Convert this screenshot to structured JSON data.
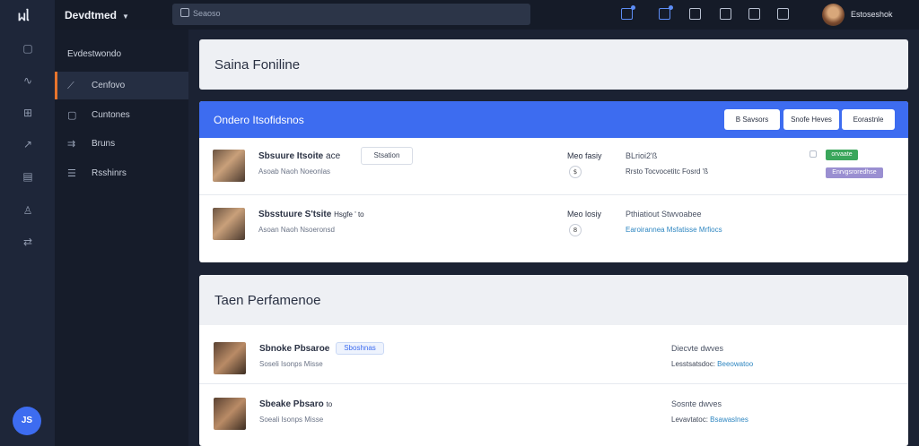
{
  "app": {
    "logo": "ᥕᥣ",
    "brand": "Devdtmed",
    "search_placeholder": "Seaoso",
    "user_name": "Estoseshok",
    "fab_label": "JS"
  },
  "rail_icons": [
    "square-icon",
    "chart-icon",
    "grid-icon",
    "trend-icon",
    "calendar-icon",
    "user-icon",
    "share-icon"
  ],
  "nav": {
    "heading": "Evdestwondo",
    "items": [
      {
        "label": "Cenfovo",
        "icon": "chart-line-icon",
        "active": true
      },
      {
        "label": "Cuntones",
        "icon": "card-icon",
        "active": false
      },
      {
        "label": "Bruns",
        "icon": "shuffle-icon",
        "active": false
      },
      {
        "label": "Rsshinrs",
        "icon": "list-icon",
        "active": false
      }
    ]
  },
  "main": {
    "page_title": "Saina Foniline",
    "list": {
      "title": "Ondero Itsofidsnos",
      "buttons": [
        "B Savsors",
        "Snofe Heves",
        "Eorastnle"
      ],
      "rows": [
        {
          "name": "Sbsuure Itsoite",
          "name_suffix": "ace",
          "tag": "Stsation",
          "sub": "Asoab Naoh   Noeonlas",
          "mid_label": "Meo fasiy",
          "mid_icon": "$",
          "right_top": "BLrioi2'ß",
          "right_bottom": "Rrsto Tocvocetitc Fosrd 'ß",
          "right_link": false,
          "badges": [
            {
              "text": "orvaate",
              "color": "#3aa65b"
            },
            {
              "text": "Enrvgsroredhse",
              "color": "#9a8fd1"
            }
          ]
        },
        {
          "name": "Sbsstuure S'tsite",
          "name_suffix": "Hsgfe ' to",
          "tag": "",
          "sub": "Asoan Naoh   Nsoeronsd",
          "mid_label": "Meo losiy",
          "mid_icon": "8",
          "right_top": "Pthiatiout Stwvoabee",
          "right_bottom": "Earoirannea Msfatisse Mrfiocs",
          "right_link": true,
          "badges": []
        }
      ]
    },
    "performance": {
      "title": "Taen Perfamenoe",
      "rows": [
        {
          "name": "Sbnoke Pbsaroe",
          "tag": "Sboshnas",
          "sub": "Soseli Isonps Misse",
          "right_top": "Diecvte dwves",
          "right_bottom_text": "Lesstsatsdoc:",
          "right_bottom_hl": "Beeowatoo"
        },
        {
          "name": "Sbeake Pbsaro",
          "name_suffix": "to",
          "tag": "",
          "sub": "Soeali Isonps Misse",
          "right_top": "Sosnte dwves",
          "right_bottom_text": "Levavtatoc:",
          "right_bottom_hl": "Bsawaslnes"
        }
      ]
    }
  },
  "colors": {
    "accent": "#3d6cf0",
    "active_marker": "#e8742c",
    "badge_green": "#3aa65b",
    "badge_purple": "#9a8fd1"
  }
}
